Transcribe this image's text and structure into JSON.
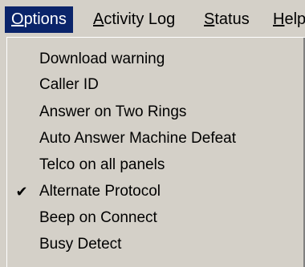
{
  "menubar": {
    "items": [
      {
        "label_first": "O",
        "label_rest": "ptions",
        "active": true
      },
      {
        "label_first": "A",
        "label_rest": "ctivity Log",
        "active": false
      },
      {
        "label_first": "S",
        "label_rest": "tatus",
        "active": false
      },
      {
        "label_first": "H",
        "label_rest": "elp",
        "active": false
      }
    ]
  },
  "options_menu": {
    "items": [
      {
        "label": "Download warning",
        "checked": false
      },
      {
        "label": "Caller ID",
        "checked": false
      },
      {
        "label": "Answer on Two Rings",
        "checked": false
      },
      {
        "label": "Auto Answer Machine Defeat",
        "checked": false
      },
      {
        "label": "Telco on all panels",
        "checked": false
      },
      {
        "label": "Alternate Protocol",
        "checked": true,
        "check_glyph": "✔"
      },
      {
        "label": "Beep on Connect",
        "checked": false
      },
      {
        "label": "Busy Detect",
        "checked": false
      }
    ]
  }
}
